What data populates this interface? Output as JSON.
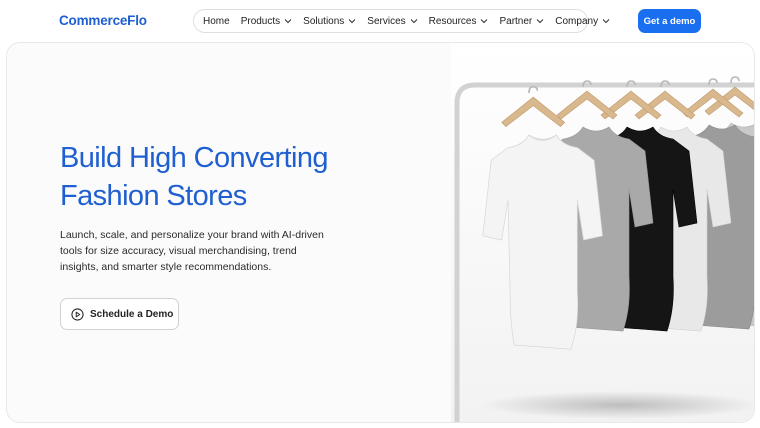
{
  "brand": {
    "logo_text": "CommerceFlo",
    "accent": "#1a6ef0",
    "title_color": "#1f5fd1"
  },
  "nav": {
    "items": [
      {
        "label": "Home",
        "dropdown": false
      },
      {
        "label": "Products",
        "dropdown": true
      },
      {
        "label": "Solutions",
        "dropdown": true
      },
      {
        "label": "Services",
        "dropdown": true
      },
      {
        "label": "Resources",
        "dropdown": true
      },
      {
        "label": "Partner",
        "dropdown": true
      },
      {
        "label": "Company",
        "dropdown": true
      }
    ],
    "cta_label": "Get a demo"
  },
  "hero": {
    "title_line1": "Build High Converting",
    "title_line2": "Fashion Stores",
    "description": "Launch, scale, and personalize your brand with AI-driven tools for size accuracy, visual merchandising, trend insights, and smarter style recommendations.",
    "button_label": "Schedule a Demo",
    "button_icon": "play-circle-icon",
    "image": {
      "subject": "t-shirts-on-clothing-rack",
      "shirts": [
        {
          "color": "#f4f4f4"
        },
        {
          "color": "#a9a9aa"
        },
        {
          "color": "#151515"
        },
        {
          "color": "#e8e8e8"
        },
        {
          "color": "#9c9c9d"
        },
        {
          "color": "#c9c9ca"
        }
      ]
    }
  }
}
